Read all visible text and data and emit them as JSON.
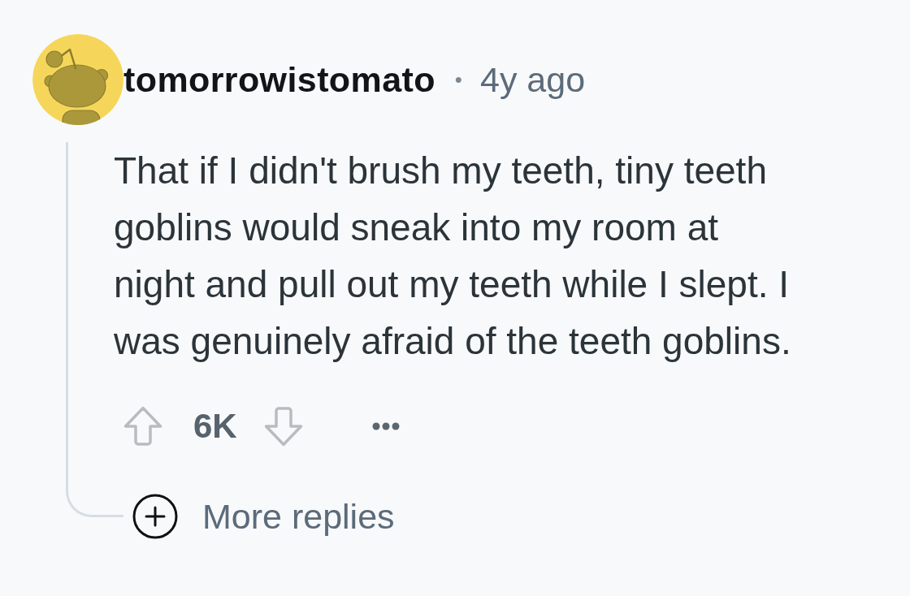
{
  "comment": {
    "author": {
      "username": "tomorrowistomato"
    },
    "separator": "•",
    "age": "4y ago",
    "body": "That if I didn't brush my teeth, tiny teeth goblins would sneak into my room at night and pull out my teeth while I slept. I was genuinely afraid of the teeth goblins.",
    "votes": {
      "score": "6K"
    },
    "more_replies": {
      "label": "More replies"
    }
  }
}
